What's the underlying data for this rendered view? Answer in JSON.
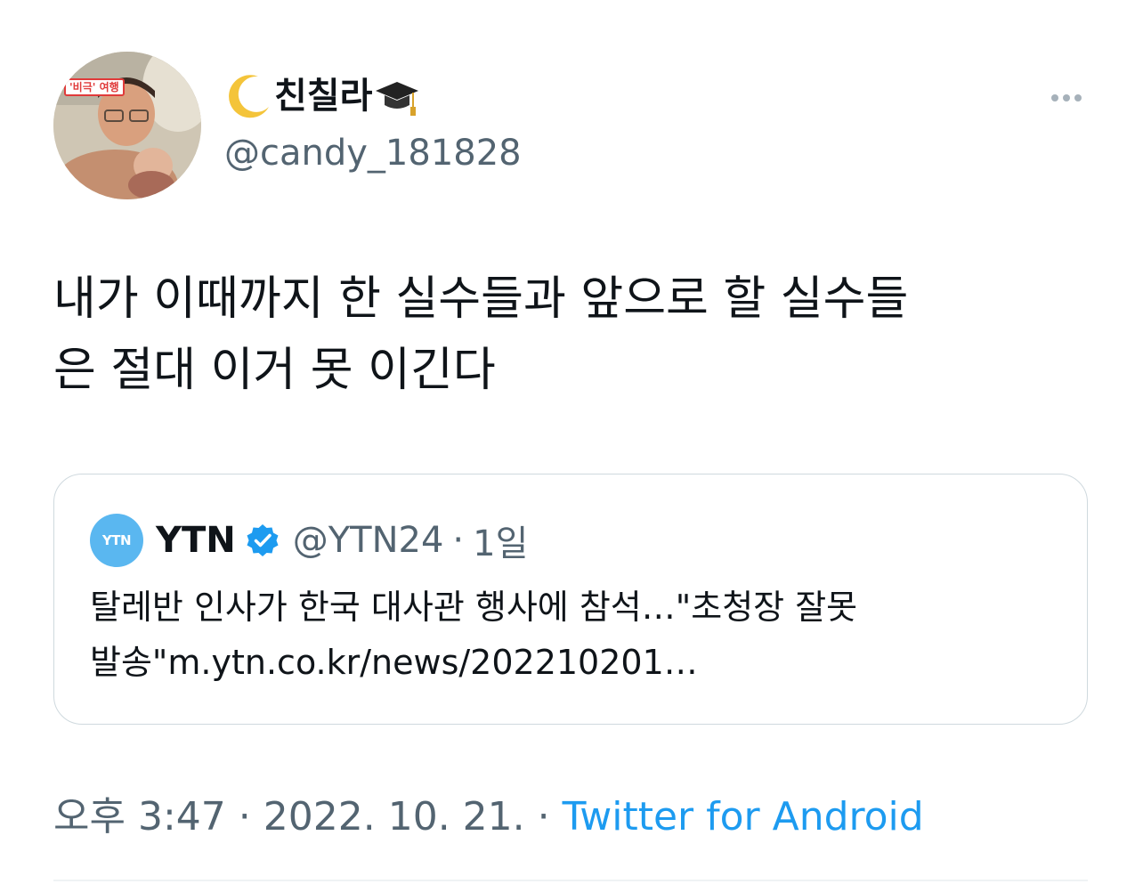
{
  "author": {
    "avatar_caption": "'비극' 여행",
    "display_name": "친칠라",
    "name_emoji_left": "crescent-moon-icon",
    "name_emoji_right": "graduation-cap-icon",
    "username": "@candy_181828"
  },
  "more_icon": "more-options-icon",
  "tweet": {
    "text": "내가 이때까지 한 실수들과 앞으로 할 실수들\n은 절대 이거 못 이긴다"
  },
  "quote": {
    "logo_text": "YTN",
    "name": "YTN",
    "verified_icon": "verified-badge-icon",
    "handle": "@YTN24",
    "separator": "·",
    "time": "1일",
    "text": "탈레반 인사가 한국 대사관 행사에 참석…\"초청장 잘못 발송\"m.ytn.co.kr/news/202210201…"
  },
  "meta": {
    "time": "오후 3:47",
    "sep1": "·",
    "date": "2022. 10. 21.",
    "sep2": "·",
    "source": "Twitter for Android"
  },
  "colors": {
    "text": "#0f1419",
    "secondary": "#536471",
    "link": "#1d9bf0",
    "border": "#cfd9de",
    "ytn_blue": "#5ab7f0"
  }
}
